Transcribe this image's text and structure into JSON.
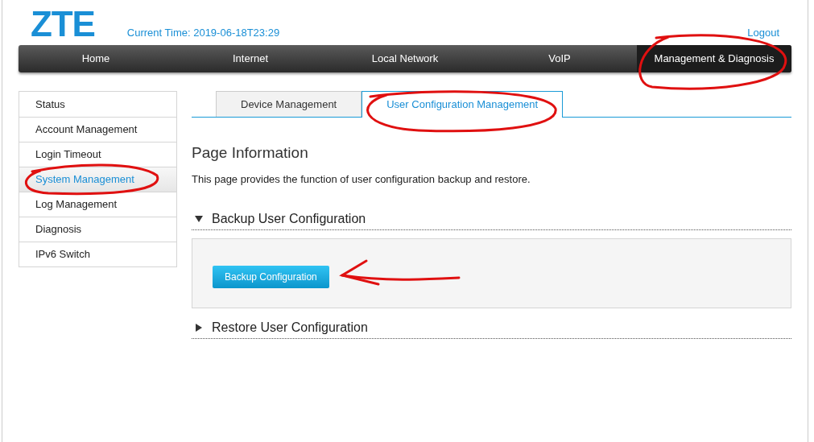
{
  "header": {
    "logo": "ZTE",
    "current_time": "Current Time: 2019-06-18T23:29",
    "logout": "Logout"
  },
  "nav": [
    {
      "label": "Home",
      "selected": false
    },
    {
      "label": "Internet",
      "selected": false
    },
    {
      "label": "Local Network",
      "selected": false
    },
    {
      "label": "VoIP",
      "selected": false
    },
    {
      "label": "Management & Diagnosis",
      "selected": true
    }
  ],
  "sidebar": {
    "items": [
      {
        "label": "Status",
        "selected": false
      },
      {
        "label": "Account Management",
        "selected": false
      },
      {
        "label": "Login Timeout",
        "selected": false
      },
      {
        "label": "System Management",
        "selected": true
      },
      {
        "label": "Log Management",
        "selected": false
      },
      {
        "label": "Diagnosis",
        "selected": false
      },
      {
        "label": "IPv6 Switch",
        "selected": false
      }
    ]
  },
  "tabs": [
    {
      "label": "Device Management",
      "selected": false
    },
    {
      "label": "User Configuration Management",
      "selected": true
    }
  ],
  "page": {
    "title": "Page Information",
    "description": "This page provides the function of user configuration backup and restore."
  },
  "sections": [
    {
      "title": "Backup User Configuration",
      "expanded": true,
      "button": "Backup Configuration"
    },
    {
      "title": "Restore User Configuration",
      "expanded": false
    }
  ]
}
